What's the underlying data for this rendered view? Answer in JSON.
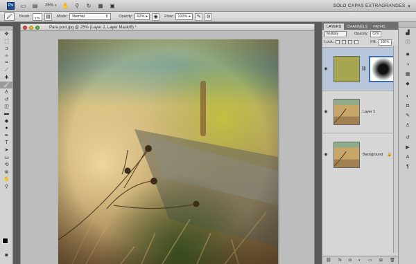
{
  "appbar": {
    "logo": "Ps",
    "zoom": "25%",
    "workspace": "SÓLO CAPAS EXTRAGRANDES",
    "icons": [
      "layout-icon",
      "hand-icon",
      "zoom-icon",
      "rotate-icon",
      "grid-icon",
      "screen-mode-icon"
    ]
  },
  "options": {
    "brush_label": "Brush:",
    "brush_size": "175",
    "mode_label": "Mode:",
    "mode_value": "Normal",
    "opacity_label": "Opacity:",
    "opacity_value": "62%",
    "flow_label": "Flow:",
    "flow_value": "100%"
  },
  "document": {
    "title": "Para post.jpg @ 25% (Layer 2, Layer Mask/8) *"
  },
  "panels": {
    "tabs": [
      "LAYERS",
      "CHANNELS",
      "PATHS"
    ],
    "blend_mode": "Multiply",
    "opacity_label": "Opacity:",
    "opacity_value": "62%",
    "lock_label": "Lock:",
    "fill_label": "Fill:",
    "fill_value": "100%",
    "layers": [
      {
        "name": "",
        "selected": true,
        "has_mask": true
      },
      {
        "name": "Layer 1",
        "selected": false,
        "has_mask": false
      },
      {
        "name": "Background",
        "selected": false,
        "has_mask": false,
        "locked": true
      }
    ]
  },
  "colors": {
    "accent": "#3c6fb8",
    "selected_layer": "#b7c6db",
    "chrome": "#d3d3d3",
    "pasteboard": "#bdbdbd"
  }
}
